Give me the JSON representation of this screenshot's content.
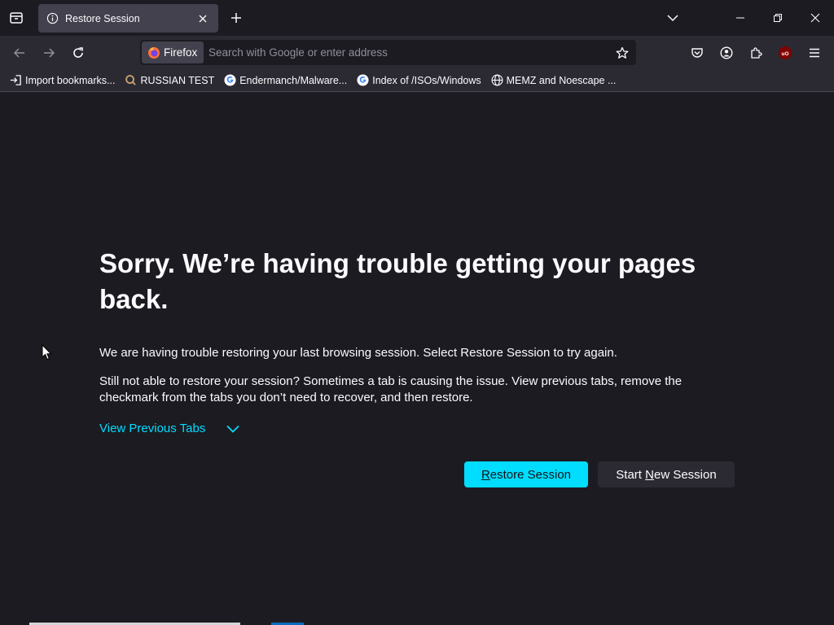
{
  "tab": {
    "title": "Restore Session"
  },
  "urlbar": {
    "identity_label": "Firefox",
    "placeholder": "Search with Google or enter address"
  },
  "bookmarks": [
    {
      "label": "Import bookmarks...",
      "icon": "import-icon"
    },
    {
      "label": "RUSSIAN TEST",
      "icon": "search-icon"
    },
    {
      "label": "Endermanch/Malware...",
      "icon": "google-icon"
    },
    {
      "label": "Index of /ISOs/Windows",
      "icon": "google-icon"
    },
    {
      "label": "MEMZ and Noescape ...",
      "icon": "globe-icon"
    }
  ],
  "content": {
    "title": "Sorry. We’re having trouble getting your pages back.",
    "para1": "We are having trouble restoring your last browsing session. Select Restore Session to try again.",
    "para2": "Still not able to restore your session? Sometimes a tab is causing the issue. View previous tabs, remove the checkmark from the tabs you don’t need to recover, and then restore.",
    "view_previous": "View Previous Tabs",
    "restore_pre": "",
    "restore_key": "R",
    "restore_post": "estore Session",
    "new_pre": "Start ",
    "new_key": "N",
    "new_post": "ew Session"
  },
  "colors": {
    "accent": "#00ddff",
    "background": "#1c1b22",
    "toolbar": "#2b2a33",
    "tab": "#42414d",
    "ublock": "#800000"
  }
}
